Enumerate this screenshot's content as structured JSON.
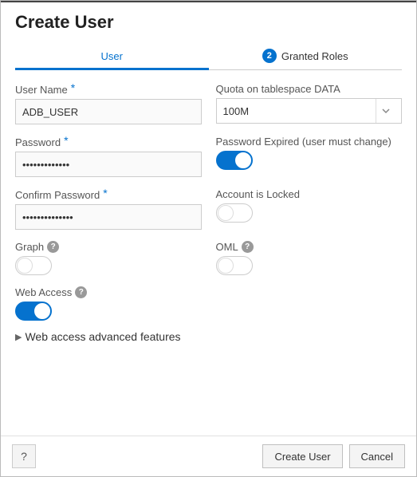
{
  "title": "Create User",
  "tabs": {
    "user": {
      "label": "User"
    },
    "roles": {
      "label": "Granted Roles",
      "badge": "2"
    }
  },
  "form": {
    "userName": {
      "label": "User Name",
      "value": "ADB_USER"
    },
    "quota": {
      "label": "Quota on tablespace DATA",
      "value": "100M"
    },
    "password": {
      "label": "Password",
      "value": "•••••••••••••"
    },
    "confirmPassword": {
      "label": "Confirm Password",
      "value": "••••••••••••••"
    },
    "passwordExpired": {
      "label": "Password Expired (user must change)"
    },
    "accountLocked": {
      "label": "Account is Locked"
    },
    "graph": {
      "label": "Graph"
    },
    "oml": {
      "label": "OML"
    },
    "webAccess": {
      "label": "Web Access"
    }
  },
  "advanced": {
    "label": "Web access advanced features"
  },
  "footer": {
    "create": "Create User",
    "cancel": "Cancel"
  }
}
